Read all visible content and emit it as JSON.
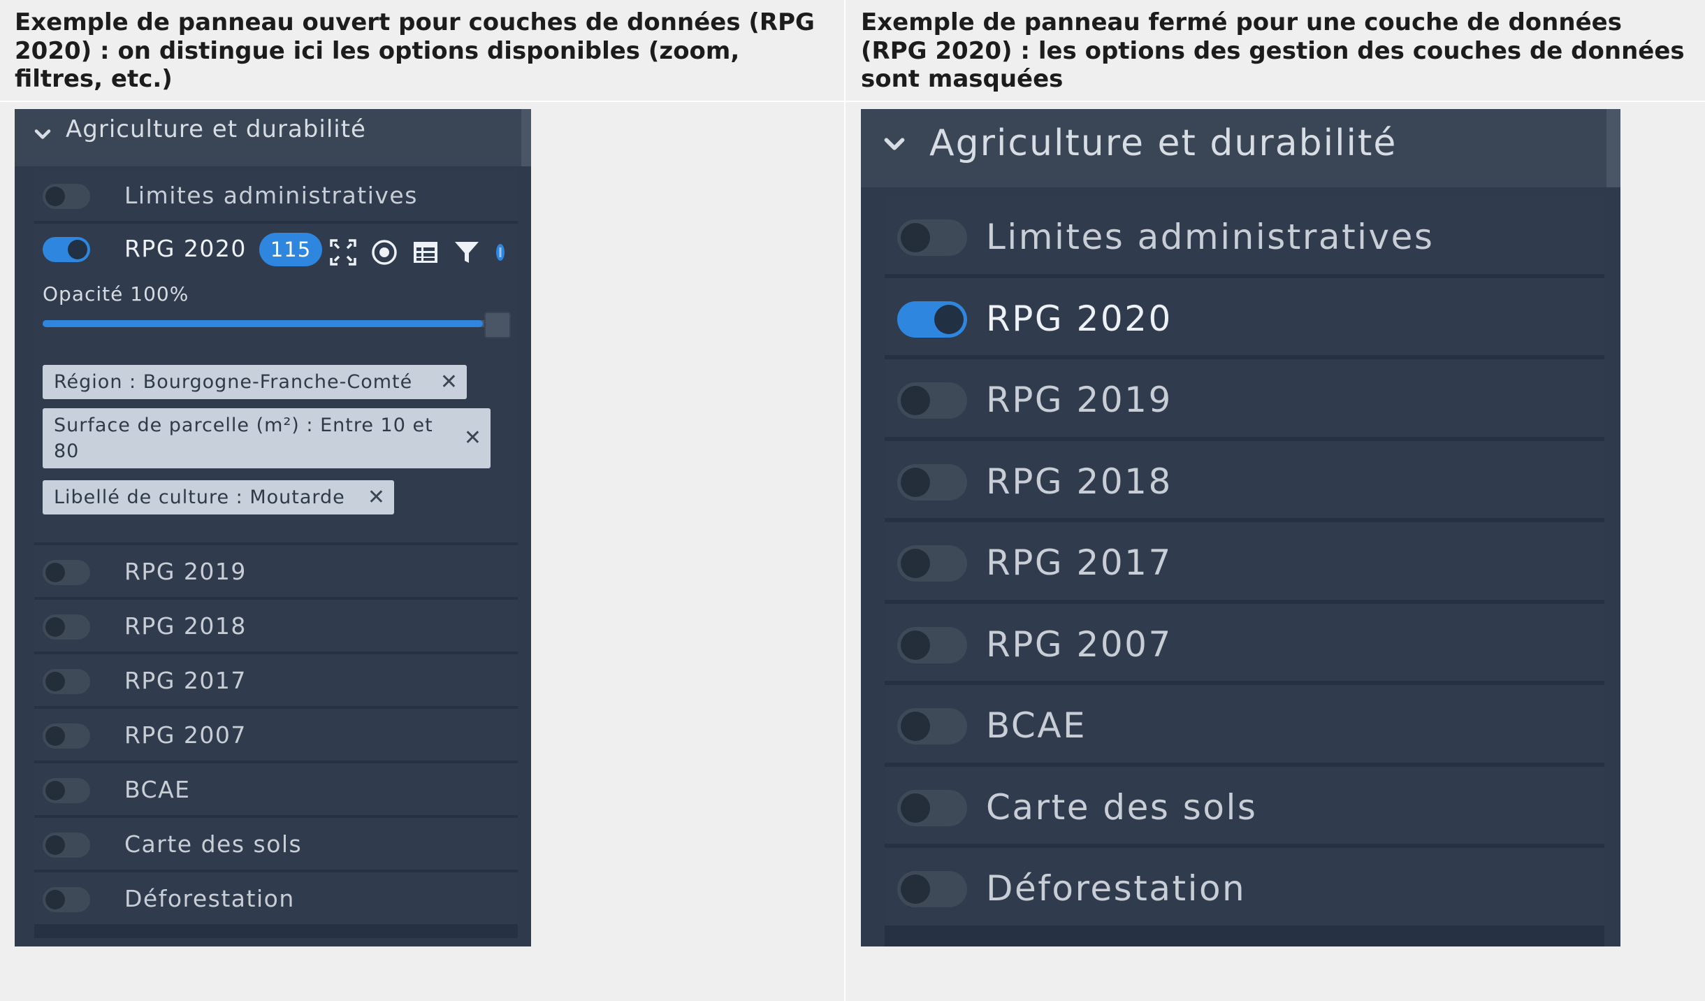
{
  "captions": {
    "left": "Exemple de panneau ouvert pour couches de données (RPG 2020) : on distingue ici les options disponibles (zoom, filtres, etc.)",
    "right": "Exemple de panneau fermé pour une couche de données (RPG 2020) : les options des gestion des couches de données sont masquées"
  },
  "open_panel": {
    "group_title": "Agriculture et durabilité",
    "layers": [
      {
        "label": "Limites administratives",
        "enabled": false
      },
      {
        "label": "RPG 2020",
        "enabled": true
      },
      {
        "label": "RPG 2019",
        "enabled": false
      },
      {
        "label": "RPG 2018",
        "enabled": false
      },
      {
        "label": "RPG 2017",
        "enabled": false
      },
      {
        "label": "RPG 2007",
        "enabled": false
      },
      {
        "label": "BCAE",
        "enabled": false
      },
      {
        "label": "Carte des sols",
        "enabled": false
      },
      {
        "label": "Déforestation",
        "enabled": false
      }
    ],
    "expanded_layer": {
      "label": "RPG 2020",
      "count_badge": "115",
      "tools": [
        "zoom-extent-icon",
        "locate-icon",
        "table-icon",
        "filter-icon",
        "info-icon"
      ],
      "opacity_label": "Opacité 100%",
      "opacity_value": 1.0,
      "filters": [
        {
          "text": "Région : Bourgogne-Franche-Comté"
        },
        {
          "text": "Surface de parcelle (m²) : Entre 10 et 80"
        },
        {
          "text": "Libellé de culture : Moutarde"
        }
      ],
      "chip_close_glyph": "✕"
    }
  },
  "closed_panel": {
    "group_title": "Agriculture et durabilité",
    "layers": [
      {
        "label": "Limites administratives",
        "enabled": false
      },
      {
        "label": "RPG 2020",
        "enabled": true
      },
      {
        "label": "RPG 2019",
        "enabled": false
      },
      {
        "label": "RPG 2018",
        "enabled": false
      },
      {
        "label": "RPG 2017",
        "enabled": false
      },
      {
        "label": "RPG 2007",
        "enabled": false
      },
      {
        "label": "BCAE",
        "enabled": false
      },
      {
        "label": "Carte des sols",
        "enabled": false
      },
      {
        "label": "Déforestation",
        "enabled": false
      }
    ]
  },
  "colors": {
    "accent": "#2e86de",
    "panel_bg": "#2f3b4c",
    "row_bg": "#303c4e",
    "chip_bg": "#c7d0db",
    "page_bg": "#efefef"
  }
}
